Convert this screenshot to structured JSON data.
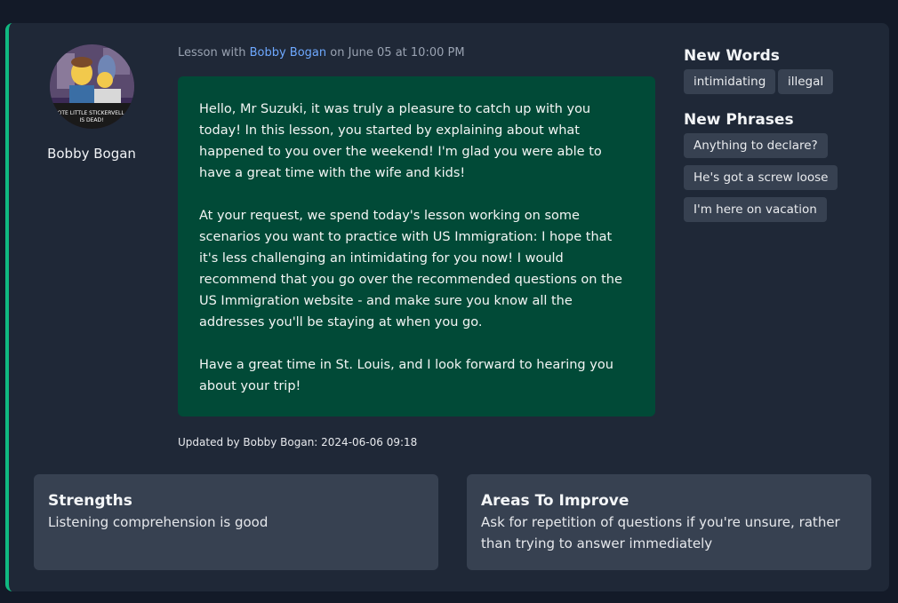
{
  "tutor": {
    "name": "Bobby Bogan",
    "avatar_caption": "A NOTE LITTLE STICKERVELL, H/I IS DEAD!"
  },
  "lesson": {
    "prefix": "Lesson with ",
    "tutor_link": "Bobby Bogan",
    "suffix": " on June 05 at 10:00 PM",
    "message_paragraphs": [
      "Hello, Mr Suzuki, it was truly a pleasure to catch up with you today! In this lesson, you started by explaining about what happened to you over the weekend! I'm glad you were able to have a great time with the wife and kids!",
      "At your request, we spend today's lesson working on some scenarios you want to practice with US Immigration: I hope that it's less challenging an intimidating for you now! I would recommend that you go over the recommended questions on the US Immigration website - and make sure you know all the addresses you'll be staying at when you go.",
      "Have a great time in St. Louis, and I look forward to hearing you about your trip!"
    ],
    "updated": "Updated by Bobby Bogan: 2024-06-06 09:18"
  },
  "new_words": {
    "title": "New Words",
    "items": [
      "intimidating",
      "illegal"
    ]
  },
  "new_phrases": {
    "title": "New Phrases",
    "items": [
      "Anything to declare?",
      "He's got a screw loose",
      "I'm here on vacation"
    ]
  },
  "strengths": {
    "title": "Strengths",
    "text": "Listening comprehension is good"
  },
  "areas_to_improve": {
    "title": "Areas To Improve",
    "text": "Ask for repetition of questions if you're unsure, rather than trying to answer immediately"
  },
  "colors": {
    "accent_border": "#10b981",
    "message_bg": "#014a37",
    "link": "#6ea8fe",
    "tag_bg": "#374151"
  }
}
